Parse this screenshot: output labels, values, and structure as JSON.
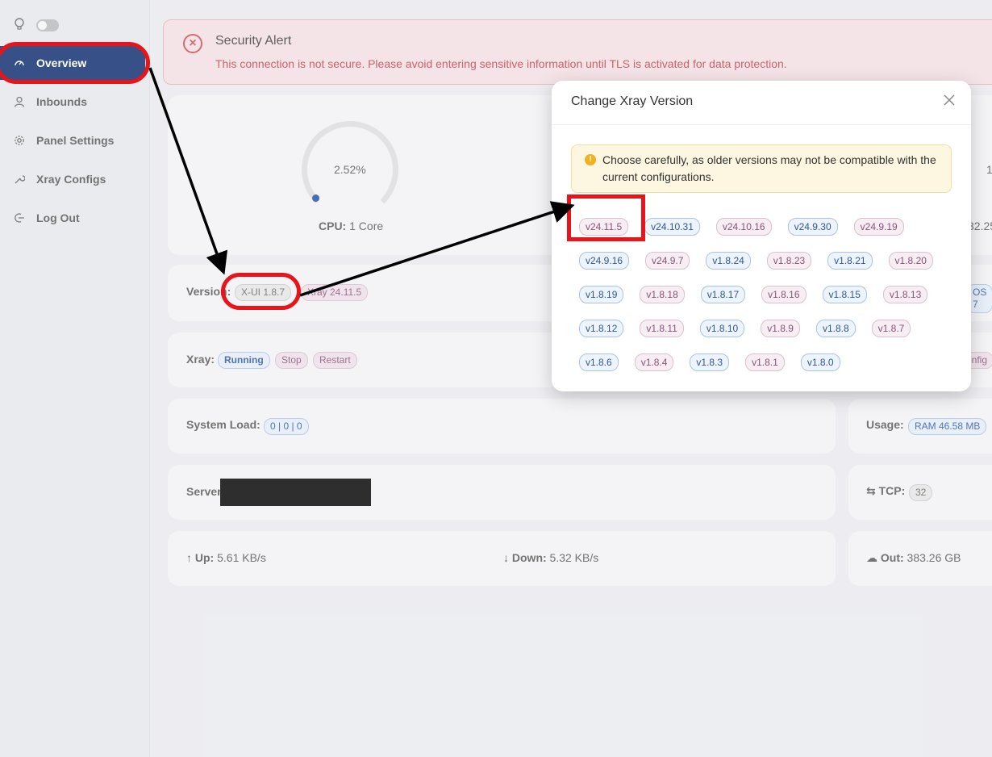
{
  "sidebar": {
    "items": [
      {
        "label": "Overview",
        "icon": "dashboard-icon"
      },
      {
        "label": "Inbounds",
        "icon": "user-icon"
      },
      {
        "label": "Panel Settings",
        "icon": "gear-icon"
      },
      {
        "label": "Xray Configs",
        "icon": "wrench-icon"
      },
      {
        "label": "Log Out",
        "icon": "logout-icon"
      }
    ]
  },
  "alert": {
    "title": "Security Alert",
    "message": "This connection is not secure. Please avoid entering sensitive information until TLS is activated for data protection."
  },
  "status": {
    "cpu_percent": "2.52%",
    "cpu_label": "CPU:",
    "cpu_value": "1 Core",
    "right_gauge_value": "1",
    "right_gauge_sub": "32.25",
    "version_label": "Version:",
    "xui_version": "X-UI 1.8.7",
    "xray_version": "Xray 24.11.5",
    "os_tag": "OS 7",
    "xray_label": "Xray:",
    "xray_state": "Running",
    "xray_stop": "Stop",
    "xray_restart": "Restart",
    "config_tag": "onfig",
    "system_load_label": "System Load:",
    "system_load_value": "0 | 0 | 0",
    "usage_label": "Usage:",
    "usage_value": "RAM 46.58 MB",
    "server_label": "Server",
    "tcp_label": "TCP:",
    "tcp_value": "32",
    "up_label": "Up:",
    "up_value": "5.61 KB/s",
    "down_label": "Down:",
    "down_value": "5.32 KB/s",
    "out_label": "Out:",
    "out_value": "383.26 GB"
  },
  "modal": {
    "title": "Change Xray Version",
    "warning": "Choose carefully, as older versions may not be compatible with the current configurations.",
    "versions": [
      [
        "v24.11.5",
        "v24.10.31",
        "v24.10.16",
        "v24.9.30",
        "v24.9.19"
      ],
      [
        "v24.9.16",
        "v24.9.7",
        "v1.8.24",
        "v1.8.23",
        "v1.8.21",
        "v1.8.20"
      ],
      [
        "v1.8.19",
        "v1.8.18",
        "v1.8.17",
        "v1.8.16",
        "v1.8.15",
        "v1.8.13"
      ],
      [
        "v1.8.12",
        "v1.8.11",
        "v1.8.10",
        "v1.8.9",
        "v1.8.8",
        "v1.8.7"
      ],
      [
        "v1.8.6",
        "v1.8.4",
        "v1.8.3",
        "v1.8.1",
        "v1.8.0"
      ]
    ]
  },
  "colors": {
    "active_nav": "#0b2a6e",
    "annotation_red": "#e8141a",
    "alert_text": "#c0414b"
  }
}
